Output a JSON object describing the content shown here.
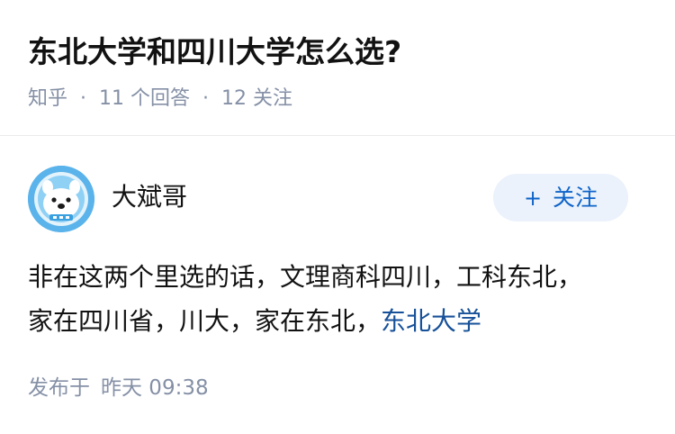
{
  "question": {
    "title": "东北大学和四川大学怎么选?",
    "meta": {
      "source": "知乎",
      "answers": "11 个回答",
      "followers": "12 关注"
    }
  },
  "author": {
    "name": "大斌哥",
    "avatar_icon": "cartoon-bear-avatar-icon",
    "follow_label": "关注",
    "follow_icon": "plus-icon"
  },
  "answer": {
    "line1": "非在这两个里选的话，文理商科四川，工科东北，",
    "line2_text": "家在四川省，川大，家在东北，",
    "line2_link": "东北大学"
  },
  "footer": {
    "published_label": "发布于",
    "published_time": "昨天 09:38"
  },
  "colors": {
    "link": "#175199",
    "meta": "#8590a6",
    "button_bg": "#ebf2fb",
    "button_text": "#0e63c9",
    "avatar_bg": "#5ab3ea"
  }
}
